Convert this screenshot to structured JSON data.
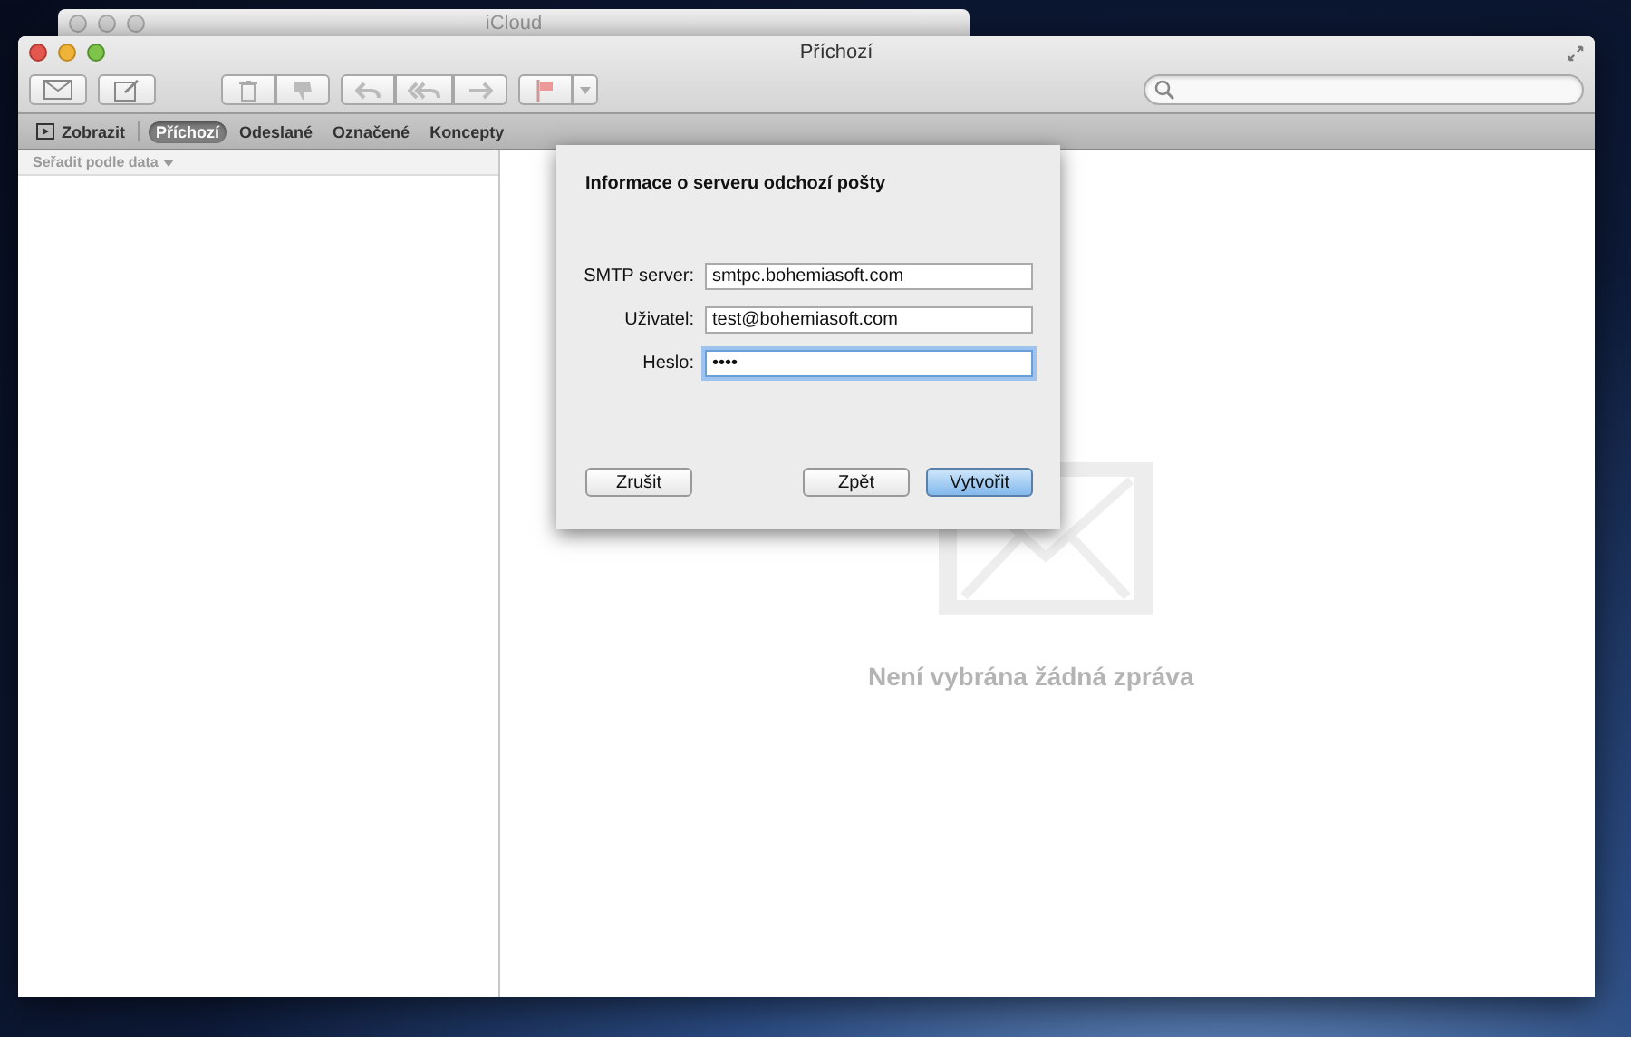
{
  "back_window": {
    "title": "iCloud"
  },
  "window": {
    "title": "Příchozí"
  },
  "favorites_bar": {
    "show_label": "Zobrazit",
    "mailboxes": [
      {
        "label": "Příchozí",
        "selected": true
      },
      {
        "label": "Odeslané",
        "selected": false
      },
      {
        "label": "Označené",
        "selected": false
      },
      {
        "label": "Koncepty",
        "selected": false
      }
    ]
  },
  "message_list": {
    "sort_label": "Seřadit podle data"
  },
  "viewer": {
    "empty_text": "Není vybrána žádná zpráva"
  },
  "dialog": {
    "title": "Informace o serveru odchozí pošty",
    "fields": [
      {
        "label": "SMTP server:",
        "value": "smtpc.bohemiasoft.com",
        "focused": false
      },
      {
        "label": "Uživatel:",
        "value": "test@bohemiasoft.com",
        "focused": false
      },
      {
        "label": "Heslo:",
        "value": "••••",
        "focused": true
      }
    ],
    "buttons": [
      {
        "label": "Zrušit",
        "default": false
      },
      {
        "label": "Zpět",
        "default": false
      },
      {
        "label": "Vytvořit",
        "default": true
      }
    ]
  }
}
